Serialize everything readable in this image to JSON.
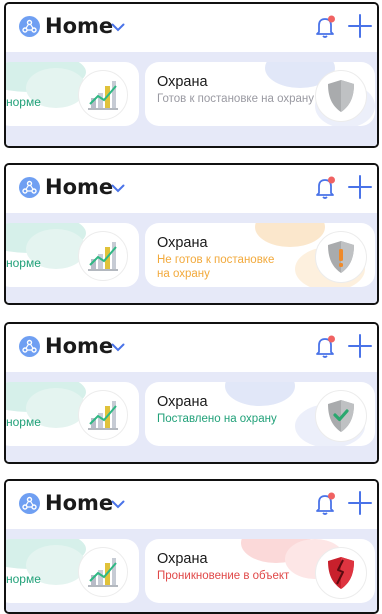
{
  "header": {
    "home_label": "Home"
  },
  "left_card": {
    "partial_text": "норме"
  },
  "panels": [
    {
      "title": "Охрана",
      "status": "Готов к постановке на охрану",
      "status_color": "#9a9aa2",
      "shield": "grey"
    },
    {
      "title": "Охрана",
      "status": "Не готов к постановке на охрану",
      "status_color": "#f2a93b",
      "shield": "orange-exclamation"
    },
    {
      "title": "Охрана",
      "status": "Поставлено на охрану",
      "status_color": "#21a179",
      "shield": "green-check"
    },
    {
      "title": "Охрана",
      "status": "Проникновение в объект",
      "status_color": "#e04848",
      "shield": "red-broken"
    }
  ],
  "colors": {
    "accent": "#4a73e8",
    "home_icon_bg": "#6f9ff2",
    "bell_dot": "#f06262",
    "strip_bg": "#e6e9f8"
  }
}
